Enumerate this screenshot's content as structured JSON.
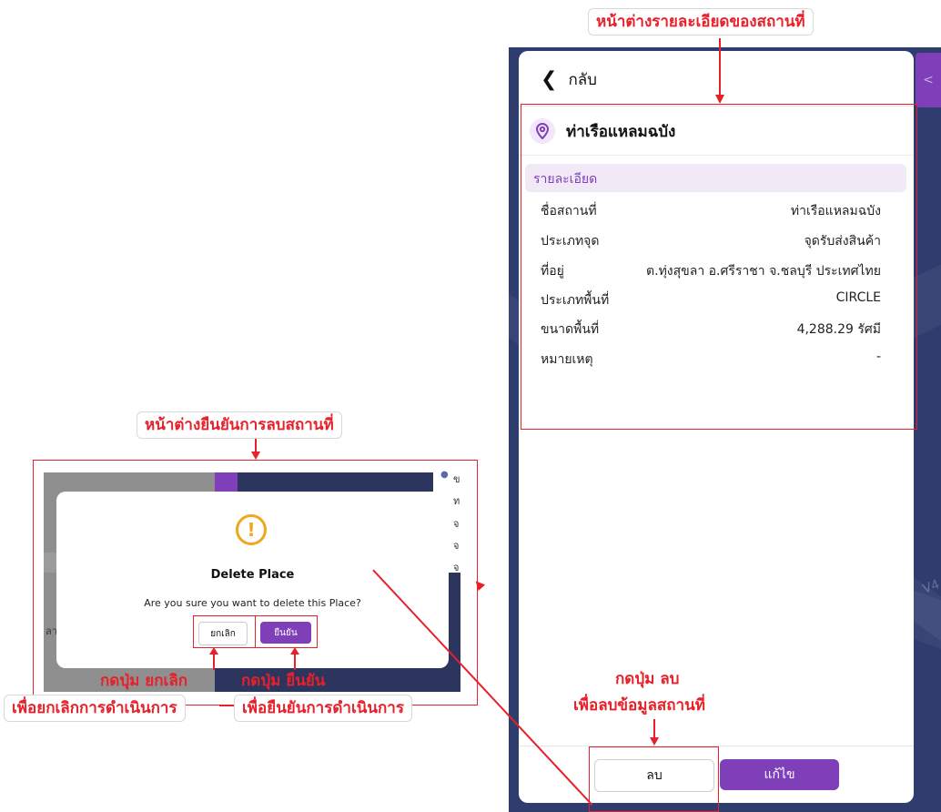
{
  "annotations": {
    "detail_window": "หน้าต่างรายละเอียดของสถานที่",
    "confirm_window": "หน้าต่างยืนยันการลบสถานที่",
    "cancel_line1": "กดปุ่ม ยกเลิก",
    "cancel_line2": "เพื่อยกเลิกการดำเนินการ",
    "confirm_line1": "กดปุ่ม ยืนยัน",
    "confirm_line2": "เพื่อยืนยันการดำเนินการ",
    "delete_line1": "กดปุ่ม ลบ",
    "delete_line2": "เพื่อลบข้อมูลสถานที่"
  },
  "panel": {
    "back_label": "กลับ",
    "place_name": "ท่าเรือแหลมฉบัง",
    "section_label": "รายละเอียด",
    "rows": [
      {
        "label": "ชื่อสถานที่",
        "value": "ท่าเรือแหลมฉบัง"
      },
      {
        "label": "ประเภทจุด",
        "value": "จุดรับส่งสินค้า"
      },
      {
        "label": "ที่อยู่",
        "value": "ต.ทุ่งสุขลา อ.ศรีราชา จ.ชลบุรี ประเทศไทย"
      },
      {
        "label": "ประเภทพื้นที่",
        "value": "CIRCLE"
      },
      {
        "label": "ขนาดพื้นที่",
        "value": "4,288.29 รัศมี"
      },
      {
        "label": "หมายเหตุ",
        "value": "-"
      }
    ],
    "delete_button": "ลบ",
    "edit_button": "แก้ไข",
    "tab_chevron": "<",
    "map_text": "V4"
  },
  "dialog": {
    "title": "Delete Place",
    "message": "Are you sure you want to delete this Place?",
    "cancel_button": "ยกเลิก",
    "confirm_button": "ยืนยัน",
    "side_text": "ลา",
    "right_letters": [
      "ข",
      "ท",
      "จ",
      "จ",
      "จ"
    ],
    "tab_chevron": "<"
  },
  "colors": {
    "accent_purple": "#7e3fb8",
    "annotation_red": "#e8202a",
    "map_navy": "#2f3d6e",
    "warning_orange": "#f0a620"
  }
}
